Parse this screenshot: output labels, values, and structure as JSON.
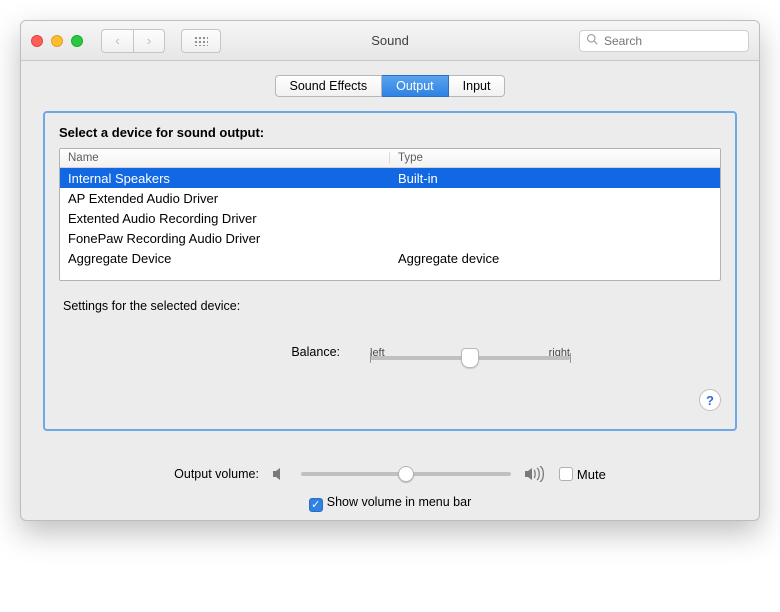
{
  "window": {
    "title": "Sound"
  },
  "search": {
    "placeholder": "Search"
  },
  "tabs": [
    {
      "label": "Sound Effects",
      "active": false
    },
    {
      "label": "Output",
      "active": true
    },
    {
      "label": "Input",
      "active": false
    }
  ],
  "panel": {
    "heading": "Select a device for sound output:",
    "columns": {
      "name": "Name",
      "type": "Type"
    },
    "devices": [
      {
        "name": "Internal Speakers",
        "type": "Built-in",
        "selected": true
      },
      {
        "name": "AP Extended Audio Driver",
        "type": "",
        "selected": false
      },
      {
        "name": "Extented Audio Recording Driver",
        "type": "",
        "selected": false
      },
      {
        "name": "FonePaw Recording Audio Driver",
        "type": "",
        "selected": false
      },
      {
        "name": "Aggregate Device",
        "type": "Aggregate device",
        "selected": false
      }
    ],
    "settings_label": "Settings for the selected device:",
    "balance": {
      "label": "Balance:",
      "left_label": "left",
      "right_label": "right",
      "value_percent": 50
    }
  },
  "footer": {
    "volume_label": "Output volume:",
    "volume_percent": 50,
    "mute": {
      "label": "Mute",
      "checked": false
    },
    "menubar": {
      "label": "Show volume in menu bar",
      "checked": true
    }
  }
}
